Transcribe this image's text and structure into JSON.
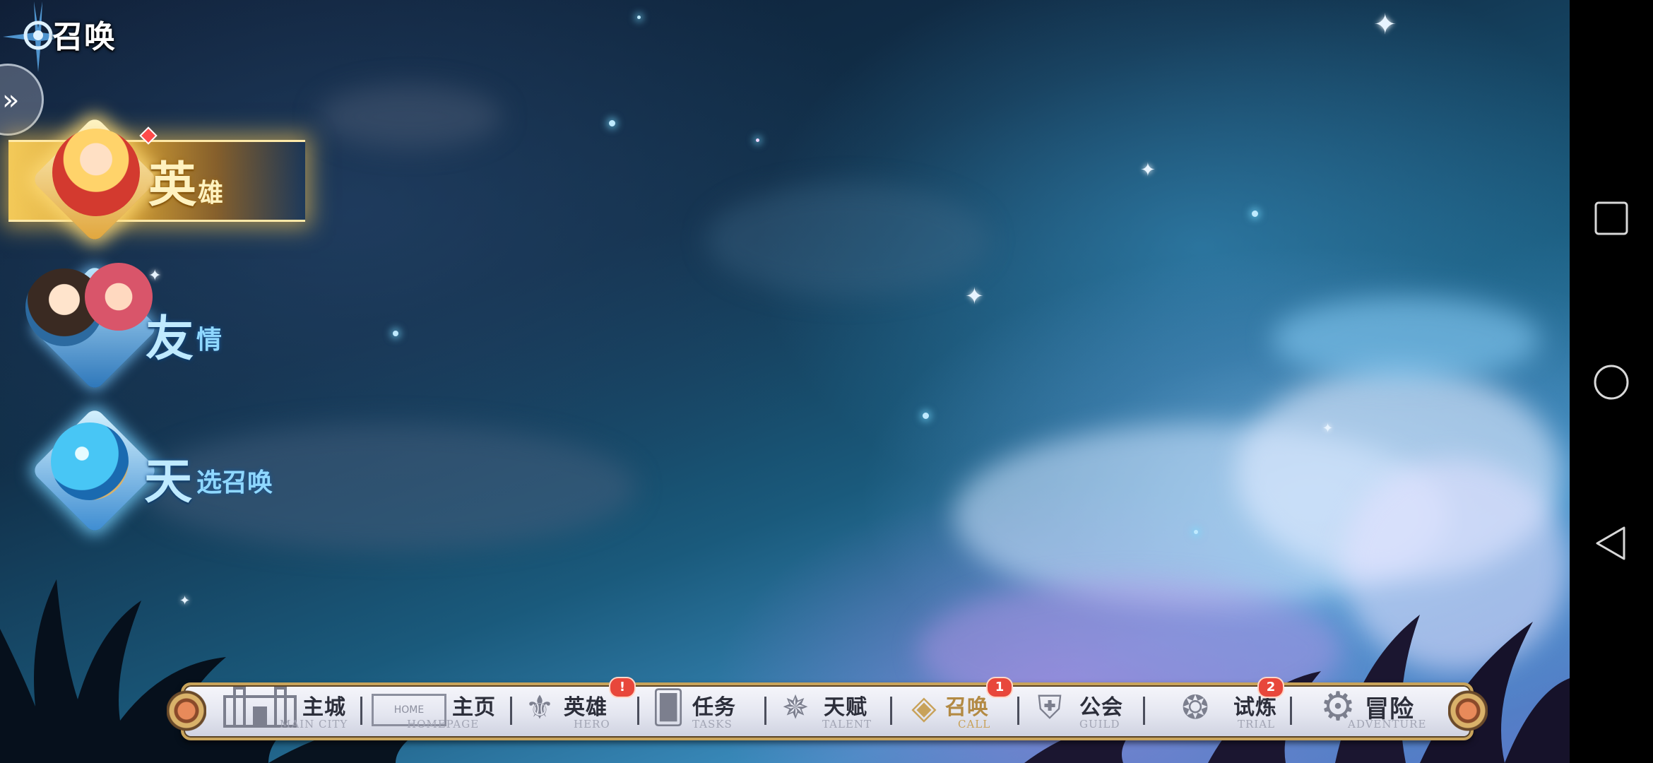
{
  "header": {
    "title": "召唤"
  },
  "summon_menu": {
    "items": [
      {
        "big": "英",
        "small": "雄",
        "selected": true,
        "has_red_dot": true
      },
      {
        "big": "友",
        "small": "情",
        "selected": false
      },
      {
        "big": "天",
        "small": "选召唤",
        "selected": false
      }
    ]
  },
  "bottom_nav": {
    "items": [
      {
        "label": "主城",
        "sub": "MAIN CITY",
        "icon": "castle-icon"
      },
      {
        "label": "主页",
        "sub": "HOMEPAGE",
        "icon": "home-sign-icon",
        "icon_text": "HOME"
      },
      {
        "label": "英雄",
        "sub": "HERO",
        "icon": "hero-emblem-icon",
        "badge": "!"
      },
      {
        "label": "任务",
        "sub": "TASKS",
        "icon": "cards-icon"
      },
      {
        "label": "天赋",
        "sub": "TALENT",
        "icon": "talent-star-icon"
      },
      {
        "label": "召唤",
        "sub": "CALL",
        "icon": "call-diamond-icon",
        "badge": "1",
        "active": true
      },
      {
        "label": "公会",
        "sub": "GUILD",
        "icon": "guild-shield-icon"
      },
      {
        "label": "试炼",
        "sub": "TRIAL",
        "icon": "trial-crest-icon",
        "badge": "2"
      },
      {
        "label": "冒险",
        "sub": "ADVENTURE",
        "icon": "adventure-gear-icon"
      }
    ]
  },
  "colors": {
    "gold": "#c9a45b",
    "badge_red": "#e8473b",
    "summon_text_blue": "#8fd8ff",
    "summon_text_gold": "#fff2c0"
  },
  "system_nav": {
    "buttons": [
      "recent-apps-square-icon",
      "home-circle-icon",
      "back-triangle-icon"
    ]
  }
}
